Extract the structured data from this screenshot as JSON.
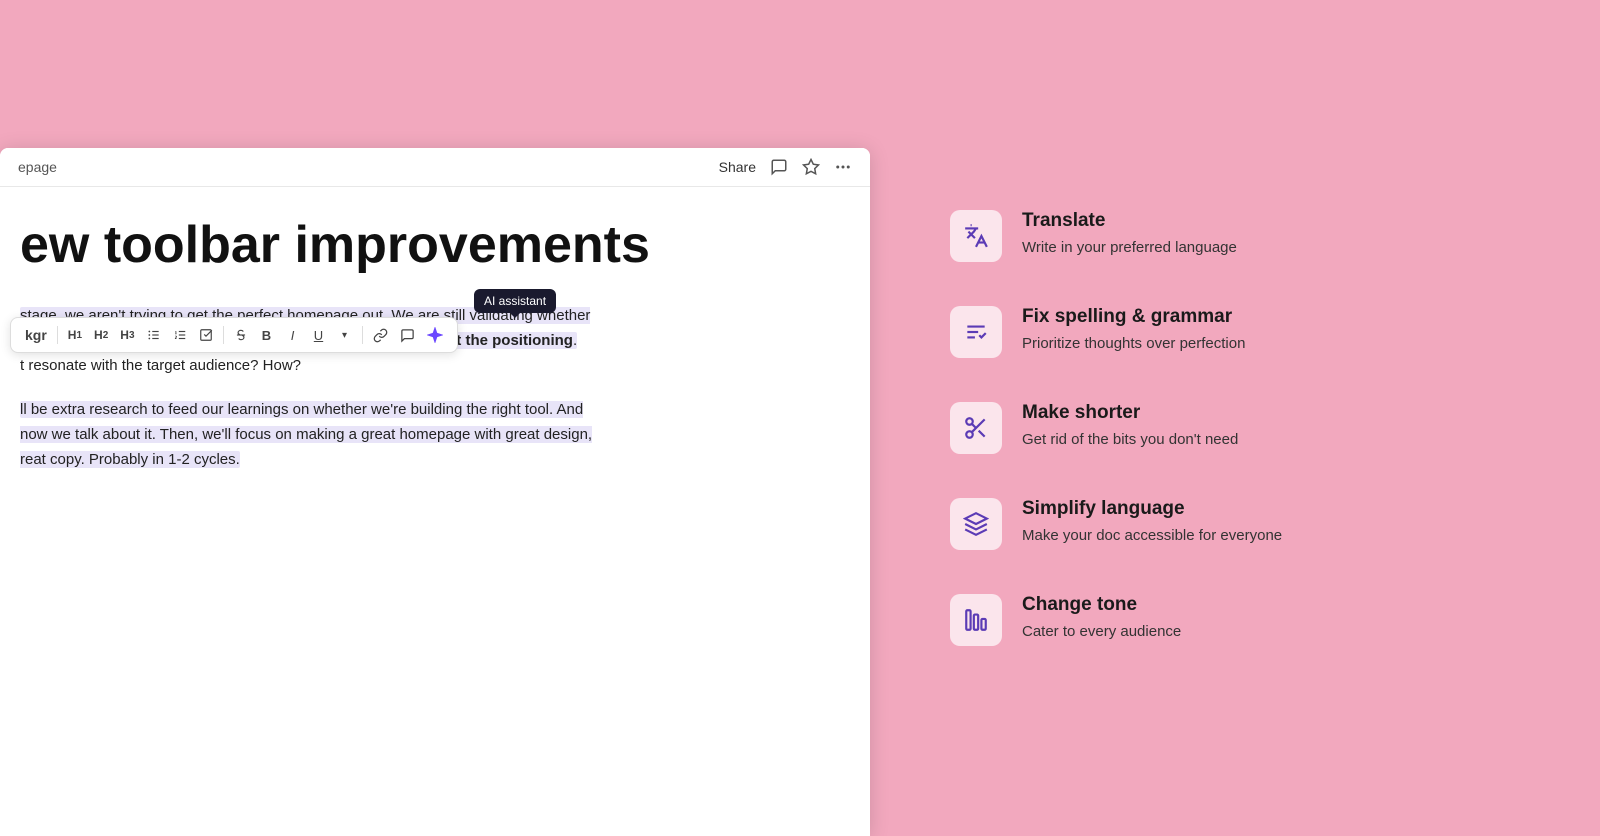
{
  "page": {
    "breadcrumb": "epage",
    "toolbar": {
      "share_label": "Share"
    },
    "document": {
      "title": "ew toolbar improvements",
      "paragraph1_prefix": "stage, we aren't trying to get the perfect homepage out. We are still validating whether",
      "paragraph1_bold": "let's use messaging as a way to test the positioning",
      "paragraph1_suffix": ".",
      "paragraph1_end": "t resonate with the target audience? How?",
      "paragraph2": "ll be extra research to feed our learnings on whether we're building the right tool. And now we talk about it. Then, we'll focus on making a great homepage with great design, reat copy. Probably in 1-2 cycles.",
      "section_label": "kgr"
    },
    "formatting_toolbar": {
      "ai_tooltip": "AI assistant",
      "items": [
        {
          "id": "h1",
          "label": "H₁",
          "icon": "h1"
        },
        {
          "id": "h2",
          "label": "H₂",
          "icon": "h2"
        },
        {
          "id": "h3",
          "label": "H₃",
          "icon": "h3"
        },
        {
          "id": "bullet",
          "label": "•≡",
          "icon": "bullet-list"
        },
        {
          "id": "numbered",
          "label": "1≡",
          "icon": "numbered-list"
        },
        {
          "id": "checkbox",
          "label": "☑",
          "icon": "checkbox"
        },
        {
          "id": "strikethrough",
          "label": "S̶",
          "icon": "strikethrough"
        },
        {
          "id": "bold",
          "label": "B",
          "icon": "bold"
        },
        {
          "id": "italic",
          "label": "I",
          "icon": "italic"
        },
        {
          "id": "underline",
          "label": "U",
          "icon": "underline"
        },
        {
          "id": "underline-more",
          "label": "▾",
          "icon": "dropdown"
        },
        {
          "id": "link",
          "label": "🔗",
          "icon": "link"
        },
        {
          "id": "comment",
          "label": "💬",
          "icon": "comment"
        },
        {
          "id": "ai",
          "label": "✦",
          "icon": "ai-assistant",
          "active": true
        }
      ]
    }
  },
  "right_panel": {
    "features": [
      {
        "id": "translate",
        "title": "Translate",
        "description": "Write in your preferred language",
        "icon": "translate-icon"
      },
      {
        "id": "fix-spelling",
        "title": "Fix spelling & grammar",
        "description": "Prioritize thoughts over perfection",
        "icon": "spelling-icon"
      },
      {
        "id": "make-shorter",
        "title": "Make shorter",
        "description": "Get rid of the bits you don't need",
        "icon": "scissors-icon"
      },
      {
        "id": "simplify-language",
        "title": "Simplify language",
        "description": "Make your doc accessible for everyone",
        "icon": "simplify-icon"
      },
      {
        "id": "change-tone",
        "title": "Change tone",
        "description": "Cater to every audience",
        "icon": "tone-icon"
      }
    ]
  }
}
